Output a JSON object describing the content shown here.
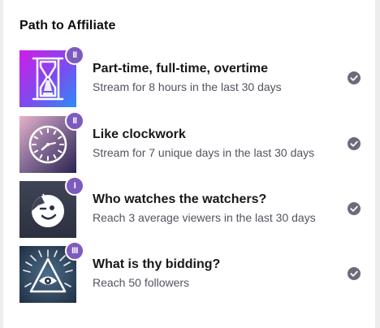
{
  "panel": {
    "title": "Path to Affiliate"
  },
  "colors": {
    "badge": "#7d5bbe",
    "check": "#6e6a7a",
    "title_text": "#18181b",
    "desc_text": "#53535f"
  },
  "steps": [
    {
      "badge": "II",
      "title": "Part-time, full-time, overtime",
      "description": "Stream for 8 hours in the last 30 days",
      "icon": "hourglass-icon",
      "completed": true
    },
    {
      "badge": "II",
      "title": "Like clockwork",
      "description": "Stream for 7 unique days in the last 30 days",
      "icon": "clock-icon",
      "completed": true
    },
    {
      "badge": "I",
      "title": "Who watches the watchers?",
      "description": "Reach 3 average viewers in the last 30 days",
      "icon": "winking-face-icon",
      "completed": true
    },
    {
      "badge": "III",
      "title": "What is thy bidding?",
      "description": "Reach 50 followers",
      "icon": "all-seeing-eye-icon",
      "completed": true
    }
  ]
}
